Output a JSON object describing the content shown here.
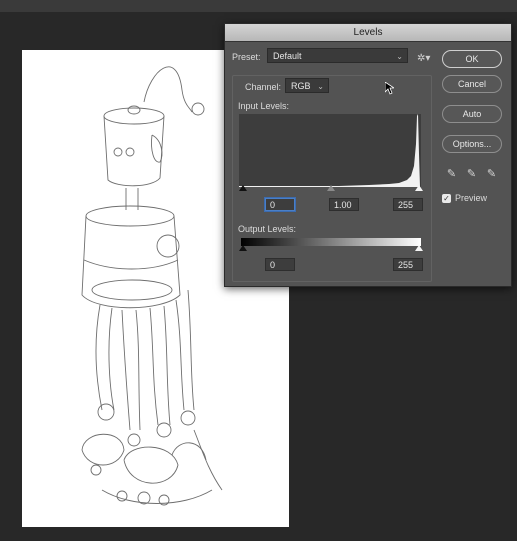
{
  "dialog": {
    "title": "Levels",
    "preset_label": "Preset:",
    "preset_value": "Default",
    "channel_label": "Channel:",
    "channel_value": "RGB",
    "input_levels_label": "Input Levels:",
    "input_black": "0",
    "input_gamma": "1.00",
    "input_white": "255",
    "output_levels_label": "Output Levels:",
    "output_black": "0",
    "output_white": "255"
  },
  "buttons": {
    "ok": "OK",
    "cancel": "Cancel",
    "auto": "Auto",
    "options": "Options..."
  },
  "preview": {
    "label": "Preview",
    "checked": true
  },
  "icons": [
    "gear-icon",
    "chevron-down-icon",
    "black-eyedropper-icon",
    "gray-eyedropper-icon",
    "white-eyedropper-icon",
    "checkbox-check-icon",
    "mouse-pointer-icon"
  ],
  "colors": {
    "dialog_bg": "#535353",
    "canvas_bg": "#ffffff",
    "workspace_bg": "#282828"
  }
}
